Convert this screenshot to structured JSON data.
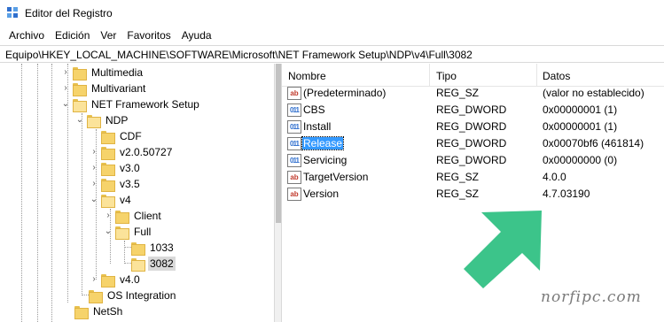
{
  "window": {
    "title": "Editor del Registro",
    "icon": "registry-editor-icon"
  },
  "menu": [
    "Archivo",
    "Edición",
    "Ver",
    "Favoritos",
    "Ayuda"
  ],
  "address": "Equipo\\HKEY_LOCAL_MACHINE\\SOFTWARE\\Microsoft\\NET Framework Setup\\NDP\\v4\\Full\\3082",
  "tree": {
    "items": [
      {
        "label": "Multimedia",
        "expander": "collapsed"
      },
      {
        "label": "Multivariant",
        "expander": "collapsed"
      },
      {
        "label": "NET Framework Setup",
        "expander": "expanded"
      },
      {
        "label": "NDP",
        "expander": "expanded"
      },
      {
        "label": "CDF",
        "expander": "none"
      },
      {
        "label": "v2.0.50727",
        "expander": "collapsed"
      },
      {
        "label": "v3.0",
        "expander": "collapsed"
      },
      {
        "label": "v3.5",
        "expander": "collapsed"
      },
      {
        "label": "v4",
        "expander": "expanded"
      },
      {
        "label": "Client",
        "expander": "collapsed"
      },
      {
        "label": "Full",
        "expander": "expanded"
      },
      {
        "label": "1033",
        "expander": "none"
      },
      {
        "label": "3082",
        "expander": "none",
        "selected": true
      },
      {
        "label": "v4.0",
        "expander": "collapsed"
      },
      {
        "label": "OS Integration",
        "expander": "none"
      },
      {
        "label": "NetSh",
        "expander": "none"
      }
    ]
  },
  "list": {
    "headers": {
      "name": "Nombre",
      "type": "Tipo",
      "data": "Datos"
    },
    "rows": [
      {
        "icon": "string-value-icon",
        "name": "(Predeterminado)",
        "type": "REG_SZ",
        "data": "(valor no establecido)"
      },
      {
        "icon": "dword-value-icon",
        "name": "CBS",
        "type": "REG_DWORD",
        "data": "0x00000001 (1)"
      },
      {
        "icon": "dword-value-icon",
        "name": "Install",
        "type": "REG_DWORD",
        "data": "0x00000001 (1)"
      },
      {
        "icon": "dword-value-icon",
        "name": "Release",
        "type": "REG_DWORD",
        "data": "0x00070bf6 (461814)",
        "selected": true
      },
      {
        "icon": "dword-value-icon",
        "name": "Servicing",
        "type": "REG_DWORD",
        "data": "0x00000000 (0)"
      },
      {
        "icon": "string-value-icon",
        "name": "TargetVersion",
        "type": "REG_SZ",
        "data": "4.0.0"
      },
      {
        "icon": "string-value-icon",
        "name": "Version",
        "type": "REG_SZ",
        "data": "4.7.03190"
      }
    ]
  },
  "overlay": {
    "arrow_color": "#3cc48a",
    "watermark": "norfipc.com"
  },
  "icon_glyphs": {
    "string": "ab",
    "dword": "011"
  }
}
